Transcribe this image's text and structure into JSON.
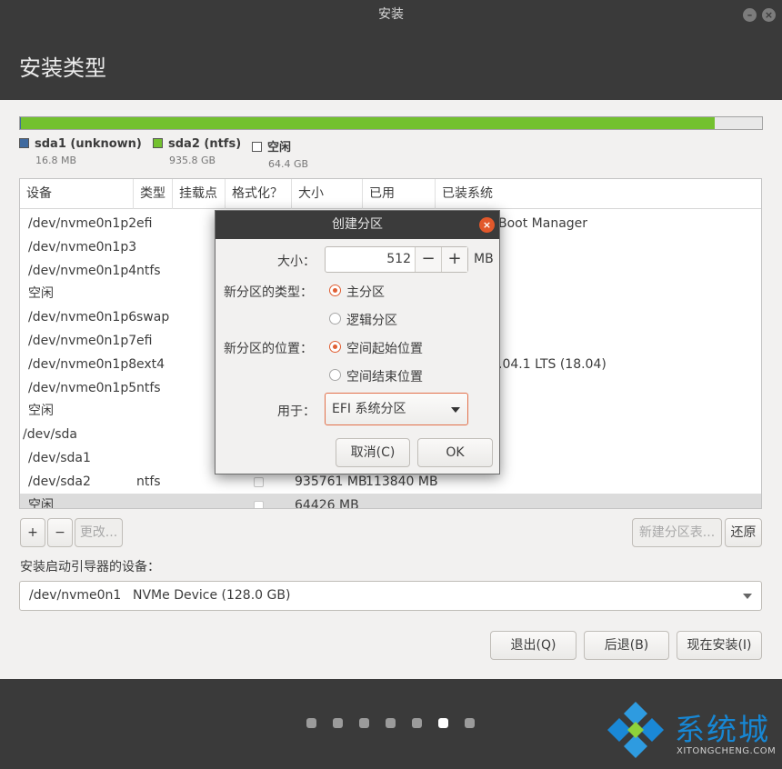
{
  "window": {
    "title": "安装",
    "page_title": "安装类型"
  },
  "disk_bar": {
    "segments": [
      {
        "color": "#3f6a9f",
        "fraction": 0.001
      },
      {
        "color": "#73c12f",
        "fraction": 0.935
      },
      {
        "color": "#e8e8e8",
        "fraction": 0.064
      }
    ]
  },
  "legend": [
    {
      "name": "sda1 (unknown)",
      "size": "16.8 MB",
      "color": "#3f6a9f"
    },
    {
      "name": "sda2 (ntfs)",
      "size": "935.8 GB",
      "color": "#73c12f"
    },
    {
      "name": "空闲",
      "size": "64.4 GB",
      "color": "#ffffff"
    }
  ],
  "table": {
    "columns": [
      "设备",
      "类型",
      "挂载点",
      "格式化？",
      "大小",
      "已用",
      "已装系统"
    ],
    "rows": [
      {
        "device": "/dev/nvme0n1p2",
        "type": "efi",
        "size": "",
        "used": "",
        "system": "Boot Manager"
      },
      {
        "device": "/dev/nvme0n1p3",
        "type": "",
        "size": "",
        "used": "",
        "system": ""
      },
      {
        "device": "/dev/nvme0n1p4",
        "type": "ntfs",
        "size": "",
        "used": "",
        "system": ""
      },
      {
        "device": "空闲",
        "type": "",
        "size": "",
        "used": "",
        "system": ""
      },
      {
        "device": "/dev/nvme0n1p6",
        "type": "swap",
        "size": "",
        "used": "",
        "system": ""
      },
      {
        "device": "/dev/nvme0n1p7",
        "type": "efi",
        "size": "",
        "used": "",
        "system": ""
      },
      {
        "device": "/dev/nvme0n1p8",
        "type": "ext4",
        "size": "",
        "used": "",
        "system": ".04.1 LTS (18.04)"
      },
      {
        "device": "/dev/nvme0n1p5",
        "type": "ntfs",
        "size": "",
        "used": "",
        "system": ""
      },
      {
        "device": "空闲",
        "type": "",
        "size": "",
        "used": "",
        "system": ""
      },
      {
        "device": "/dev/sda",
        "type": "",
        "size": "",
        "used": "",
        "system": ""
      },
      {
        "device": "/dev/sda1",
        "type": "",
        "size": "",
        "used": "",
        "system": ""
      },
      {
        "device": "/dev/sda2",
        "type": "ntfs",
        "size": "935761 MB",
        "used": "113840 MB",
        "system": ""
      },
      {
        "device": "空闲",
        "type": "",
        "size": "64426 MB",
        "used": "",
        "system": ""
      }
    ]
  },
  "table_buttons": {
    "add": "+",
    "remove": "−",
    "change": "更改...",
    "new_table": "新建分区表...",
    "revert": "还原"
  },
  "bootloader": {
    "label": "安装启动引导器的设备：",
    "device": "/dev/nvme0n1",
    "description": "NVMe Device (128.0 GB)"
  },
  "actions": {
    "quit": "退出(Q)",
    "back": "后退(B)",
    "install": "现在安装(I)"
  },
  "dialog": {
    "title": "创建分区",
    "size_label": "大小：",
    "size_value": "512",
    "size_unit": "MB",
    "minus": "−",
    "plus": "+",
    "type_label": "新分区的类型：",
    "type_primary": "主分区",
    "type_logical": "逻辑分区",
    "location_label": "新分区的位置：",
    "location_start": "空间起始位置",
    "location_end": "空间结束位置",
    "use_label": "用于：",
    "use_value": "EFI 系统分区",
    "cancel": "取消(C)",
    "ok": "OK"
  },
  "watermark": {
    "text": "系统城",
    "subtext": "XITONGCHENG.COM"
  }
}
